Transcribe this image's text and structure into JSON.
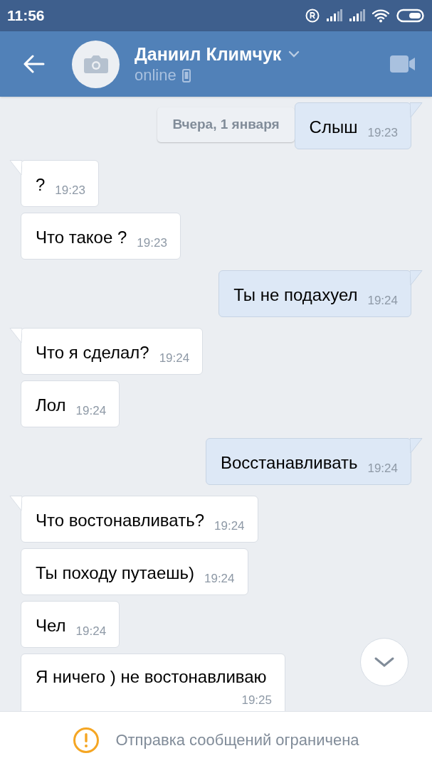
{
  "status_bar": {
    "time": "11:56"
  },
  "header": {
    "name": "Даниил Климчук",
    "status": "online"
  },
  "date_chip": "Вчера, 1 января",
  "messages": [
    {
      "kind": "outgoing",
      "text": "Слыш",
      "time": "19:23",
      "tail": true
    },
    {
      "kind": "incoming",
      "text": "?",
      "time": "19:23",
      "tail": true
    },
    {
      "kind": "incoming",
      "text": "Что такое ?",
      "time": "19:23",
      "tail": false
    },
    {
      "kind": "outgoing",
      "text": "Ты не подахуел",
      "time": "19:24",
      "tail": true
    },
    {
      "kind": "incoming",
      "text": "Что я сделал?",
      "time": "19:24",
      "tail": true
    },
    {
      "kind": "incoming",
      "text": "Лол",
      "time": "19:24",
      "tail": false
    },
    {
      "kind": "outgoing",
      "text": "Восстанавливать",
      "time": "19:24",
      "tail": true
    },
    {
      "kind": "incoming",
      "text": "Что востонавливать?",
      "time": "19:24",
      "tail": true
    },
    {
      "kind": "incoming",
      "text": "Ты походу путаешь)",
      "time": "19:24",
      "tail": false
    },
    {
      "kind": "incoming",
      "text": "Чел",
      "time": "19:24",
      "tail": false
    },
    {
      "kind": "incoming",
      "text": "Я ничего ) не востонавливаю",
      "time": "19:25",
      "tail": false
    }
  ],
  "restriction_notice": "Отправка сообщений ограничена"
}
